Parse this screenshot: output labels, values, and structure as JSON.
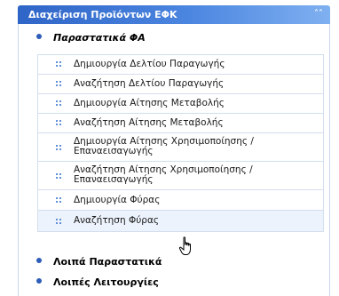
{
  "panel": {
    "title": "Διαχείριση Προϊόντων ΕΦΚ",
    "collapse_icon": "double-chevron-up-icon"
  },
  "sections": [
    {
      "label": "Παραστατικά ΦΑ",
      "expanded": true
    },
    {
      "label": "Λοιπά Παραστατικά",
      "expanded": false
    },
    {
      "label": "Λοιπές Λειτουργίες",
      "expanded": false
    }
  ],
  "items": [
    {
      "label": "Δημιουργία Δελτίου Παραγωγής"
    },
    {
      "label": "Αναζήτηση Δελτίου Παραγωγής"
    },
    {
      "label": "Δημιουργία Αίτησης Μεταβολής"
    },
    {
      "label": "Αναζήτηση Αίτησης Μεταβολής"
    },
    {
      "label": "Δημιουργία Αίτησης Χρησιμοποίησης / Επαναεισαγωγής"
    },
    {
      "label": "Αναζήτηση Αίτησης Χρησιμοποίησης / Επαναεισαγωγής"
    },
    {
      "label": "Δημιουργία Φύρας"
    },
    {
      "label": "Αναζήτηση Φύρας"
    }
  ],
  "colors": {
    "header_start": "#2f65c7",
    "header_end": "#7fb0f0",
    "bullet": "#2d5db8",
    "item_icon": "#5f8fd6",
    "hover_bg": "#edf3fc"
  },
  "item_icon": "dotted-square-icon",
  "cursor_icon": "hand-pointer-icon"
}
